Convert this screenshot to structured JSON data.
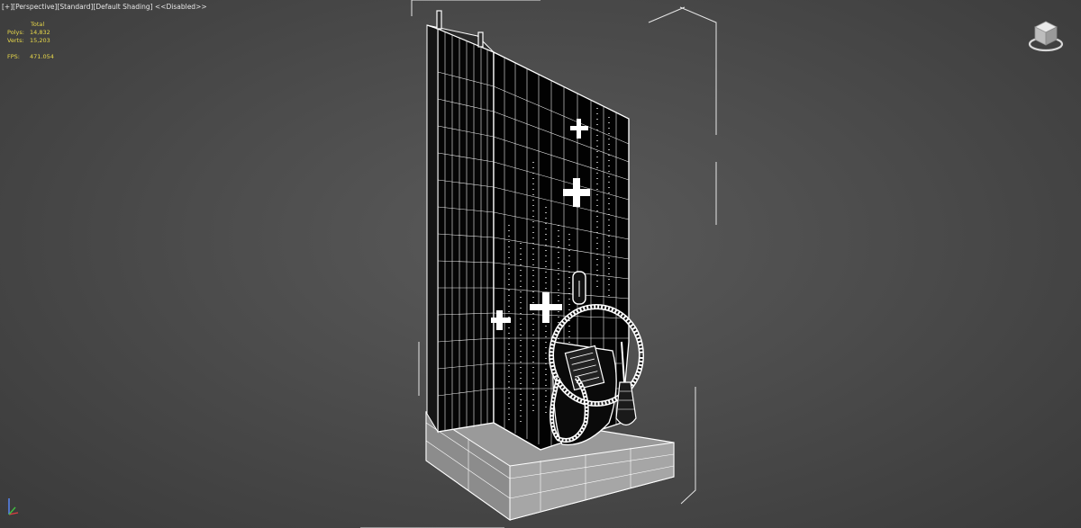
{
  "viewport": {
    "label_plus": "[+]",
    "label_view": "[Perspective]",
    "label_shading_mode": "[Standard]",
    "label_shading": "[Default Shading]",
    "label_status": "<<Disabled>>"
  },
  "stats": {
    "total_label": "Total",
    "polys_label": "Polys:",
    "polys_value": "14,832",
    "verts_label": "Verts:",
    "verts_value": "15,203",
    "fps_label": "FPS:",
    "fps_value": "471.054"
  },
  "colors": {
    "background": "#4c4c4c",
    "stats_text": "#e8d84a",
    "wire": "#ffffff"
  },
  "icons": [
    "viewcube-icon",
    "axis-gizmo-icon"
  ]
}
